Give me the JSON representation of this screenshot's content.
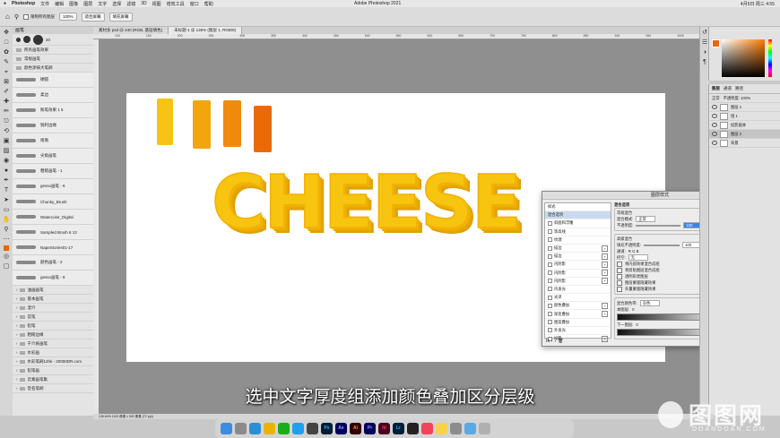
{
  "menubar": {
    "app": "Photoshop",
    "items": [
      "文件",
      "编辑",
      "图像",
      "图层",
      "文字",
      "选择",
      "滤镜",
      "3D",
      "视图",
      "增效工具",
      "窗口",
      "帮助"
    ],
    "window_title": "Adobe Photoshop 2021",
    "clock": "4月5日 周三 4:55"
  },
  "options": {
    "checkbox_label": "限制所有图层",
    "zoom": "100%",
    "fit_btn": "适合屏幕",
    "fill_btn": "填充屏幕"
  },
  "doc_tabs": [
    {
      "label": "素材多 psd @ 240 (RGB, 基层填色)"
    },
    {
      "label": "未标题-1 @ 136% (图层 1, RGB/8)"
    }
  ],
  "ruler_ticks": [
    "100",
    "150",
    "200",
    "250",
    "300",
    "350",
    "400",
    "450",
    "500",
    "550",
    "600",
    "650",
    "700",
    "750",
    "800",
    "850",
    "900",
    "950",
    "1000",
    "1050",
    "1100",
    "1150"
  ],
  "brushes": {
    "panel_title": "画笔",
    "size": "20",
    "groups_top": [
      "所有画笔效果",
      "常规画笔",
      "颜色涂抹大笔刷"
    ],
    "items": [
      "硬圆",
      "柔边",
      "粉笔效果 1 5",
      "锐利边缘",
      "喷溅",
      "尖角画笔",
      "粗糙画笔 - 1",
      "gesso画笔 - 6",
      "Chunky_Brush",
      "Watercolor_Digital",
      "Sampled Brush 6 13",
      "NapeStories01-17",
      "颜色画笔 - 2",
      "gesso画笔 - 8"
    ],
    "folders": [
      "油画画笔",
      "基本画笔",
      "湿介",
      "炭笔",
      "铅笔",
      "粗糙边缘",
      "干介质画笔",
      "水彩画",
      "水彩笔刷12hk - 20000DR.com",
      "铅笔画",
      "云素画笔集",
      "签名笔刷"
    ]
  },
  "canvas": {
    "swatches": [
      "#f7c416",
      "#f2a50c",
      "#f08a0c",
      "#ea6a08"
    ],
    "headline": "CHEESE"
  },
  "dialog": {
    "title": "图层样式",
    "list": [
      {
        "label": "样式",
        "cb": false,
        "plus": false,
        "sel": false
      },
      {
        "label": "混合选项",
        "cb": false,
        "plus": false,
        "sel": true
      },
      {
        "label": "斜面和浮雕",
        "cb": true,
        "plus": false,
        "sel": false
      },
      {
        "label": "等高线",
        "cb": true,
        "plus": false,
        "sel": false
      },
      {
        "label": "纹理",
        "cb": true,
        "plus": false,
        "sel": false
      },
      {
        "label": "描边",
        "cb": true,
        "plus": true,
        "sel": false
      },
      {
        "label": "描边",
        "cb": true,
        "plus": true,
        "sel": false
      },
      {
        "label": "内阴影",
        "cb": true,
        "plus": true,
        "sel": false
      },
      {
        "label": "内阴影",
        "cb": true,
        "plus": true,
        "sel": false
      },
      {
        "label": "内阴影",
        "cb": true,
        "plus": true,
        "sel": false
      },
      {
        "label": "内发光",
        "cb": true,
        "plus": false,
        "sel": false
      },
      {
        "label": "光泽",
        "cb": true,
        "plus": false,
        "sel": false
      },
      {
        "label": "颜色叠加",
        "cb": true,
        "plus": true,
        "sel": false
      },
      {
        "label": "渐变叠加",
        "cb": true,
        "plus": true,
        "sel": false
      },
      {
        "label": "图案叠加",
        "cb": true,
        "plus": false,
        "sel": false
      },
      {
        "label": "外发光",
        "cb": true,
        "plus": false,
        "sel": false
      },
      {
        "label": "投影",
        "cb": true,
        "plus": true,
        "sel": false
      }
    ],
    "blend_title": "混合选项",
    "general_title": "常规混合",
    "blend_mode_label": "混合模式:",
    "blend_mode": "正常",
    "opacity_label": "不透明度:",
    "opacity": "100",
    "adv_title": "高级混合",
    "fill_opacity_label": "填充不透明度:",
    "fill_opacity": "100",
    "channels_label": "通道:",
    "channels": "R  G  B",
    "knockout_label": "挖空:",
    "knockout": "无",
    "options": [
      "将内部效果混合成组",
      "将剪贴图层混合成组",
      "透明形状图层",
      "图层蒙版隐藏效果",
      "矢量蒙版隐藏效果"
    ],
    "blendif_label": "混合颜色带:",
    "blendif": "灰色",
    "this_layer": "本图层:",
    "under_layer": "下一图层:",
    "v0": "0",
    "v255": "255",
    "ok": "确定",
    "cancel": "取消",
    "new_style": "新建样式...",
    "preview_label": "预览"
  },
  "layers_panel": {
    "tabs": [
      "图层",
      "通道",
      "路径"
    ],
    "mode": "正常",
    "opacity_label": "不透明度: 100%",
    "rows": [
      {
        "label": "图层 1",
        "sel": false
      },
      {
        "label": "组 1",
        "sel": false
      },
      {
        "label": "投影副本",
        "sel": false
      },
      {
        "label": "图层 2",
        "sel": true
      },
      {
        "label": "背景",
        "sel": false
      }
    ]
  },
  "status": "136.64%    1190 像素 x 500 像素 (72 ppi)",
  "subtitle": "选中文字厚度组添加颜色叠加区分层级",
  "watermark": {
    "main": "图图网",
    "sub": "DOANDOAN.COM"
  }
}
